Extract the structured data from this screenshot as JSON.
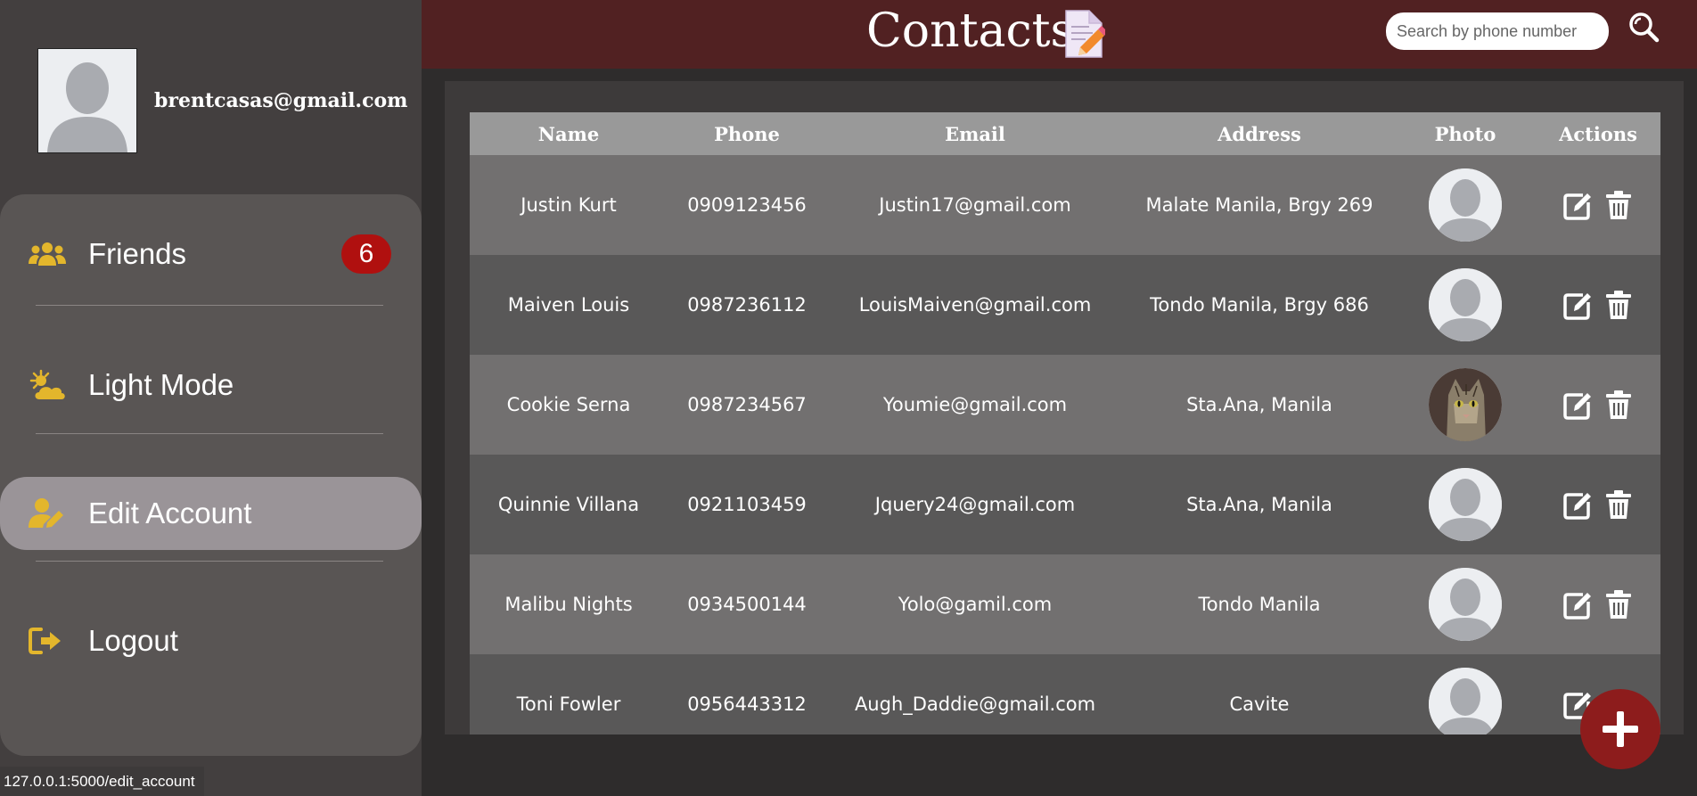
{
  "user": {
    "email": "brentcasas@gmail.com"
  },
  "menu": [
    {
      "label": "Friends",
      "icon": "users-icon",
      "badge": "6"
    },
    {
      "label": "Light Mode",
      "icon": "sun-cloud-icon"
    },
    {
      "label": "Edit Account",
      "icon": "user-edit-icon",
      "active": true
    },
    {
      "label": "Logout",
      "icon": "logout-icon"
    }
  ],
  "header": {
    "title": "Contacts",
    "title_icon": "memo-icon"
  },
  "search": {
    "placeholder": "Search by phone number"
  },
  "table": {
    "columns": [
      "Name",
      "Phone",
      "Email",
      "Address",
      "Photo",
      "Actions"
    ],
    "rows": [
      {
        "name": "Justin Kurt",
        "phone": "0909123456",
        "email": "Justin17@gmail.com",
        "address": "Malate Manila, Brgy 269",
        "photo": "default-avatar"
      },
      {
        "name": "Maiven Louis",
        "phone": "0987236112",
        "email": "LouisMaiven@gmail.com",
        "address": "Tondo Manila, Brgy 686",
        "photo": "default-avatar"
      },
      {
        "name": "Cookie Serna",
        "phone": "0987234567",
        "email": "Youmie@gmail.com",
        "address": "Sta.Ana, Manila",
        "photo": "cat-photo"
      },
      {
        "name": "Quinnie Villana",
        "phone": "0921103459",
        "email": "Jquery24@gmail.com",
        "address": "Sta.Ana, Manila",
        "photo": "default-avatar"
      },
      {
        "name": "Malibu Nights",
        "phone": "0934500144",
        "email": "Yolo@gamil.com",
        "address": "Tondo Manila",
        "photo": "default-avatar"
      },
      {
        "name": "Toni Fowler",
        "phone": "0956443312",
        "email": "Augh_Daddie@gmail.com",
        "address": "Cavite",
        "photo": "default-avatar"
      }
    ]
  },
  "status_bar": {
    "url": "127.0.0.1:5000/edit_account"
  },
  "colors": {
    "header": "#512122",
    "accent_icon": "#e3b62c",
    "badge": "#b0100f",
    "fab": "#8d1c1c"
  }
}
